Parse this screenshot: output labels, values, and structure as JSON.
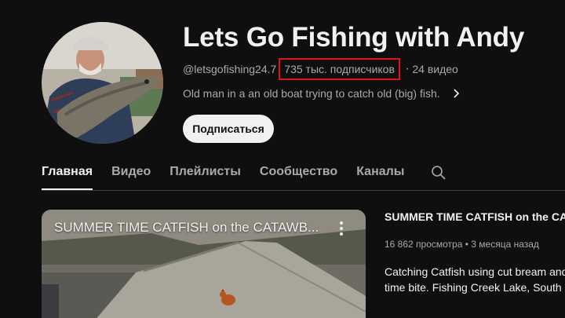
{
  "channel": {
    "title": "Lets Go Fishing with Andy",
    "handle": "@letsgofishing24.7",
    "subscribers": "735 тыс. подписчиков",
    "videos": "24 видео",
    "meta_separator": "‧",
    "description": "Old man in a an old boat trying to catch old (big) fish.",
    "subscribe_label": "Подписаться"
  },
  "tabs": [
    {
      "label": "Главная",
      "active": true
    },
    {
      "label": "Видео",
      "active": false
    },
    {
      "label": "Плейлисты",
      "active": false
    },
    {
      "label": "Сообщество",
      "active": false
    },
    {
      "label": "Каналы",
      "active": false
    }
  ],
  "featured_video": {
    "thumb_title": "SUMMER TIME CATFISH on the CATAWB...",
    "title": "SUMMER TIME CATFISH on the CATAW",
    "views": "16 862 просмотра",
    "age": "3 месяца назад",
    "meta_separator": "•",
    "description": "Catching Catfish using cut bream and time bite. Fishing Creek Lake, South Ca"
  },
  "icons": {
    "search": "search-icon",
    "chevron": "chevron-right-icon",
    "more": "more-vert-icon"
  },
  "colors": {
    "background": "#0f0f0f",
    "highlight_box": "#e0101c",
    "subscribe_bg": "#f1f1f1"
  }
}
